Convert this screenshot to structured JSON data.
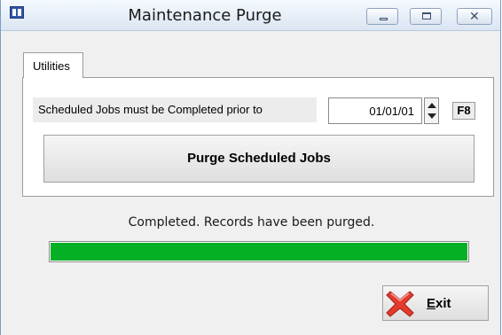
{
  "window": {
    "title": "Maintenance Purge",
    "icon": "form-icon",
    "buttons": {
      "minimize": "minimize",
      "maximize": "maximize",
      "close": "close"
    }
  },
  "tabs": [
    {
      "label": "Utilities",
      "selected": true
    }
  ],
  "form": {
    "scheduled_label": "Scheduled Jobs must be Completed prior to",
    "date_value": "01/01/01",
    "f8_label": "F8",
    "purge_button": "Purge Scheduled Jobs"
  },
  "status": {
    "message": "Completed. Records have been purged.",
    "progress": 1.0,
    "progress_color": "#06b025"
  },
  "exit_button": {
    "mnemonic": "E",
    "rest": "xit",
    "icon": "red-x-icon"
  }
}
